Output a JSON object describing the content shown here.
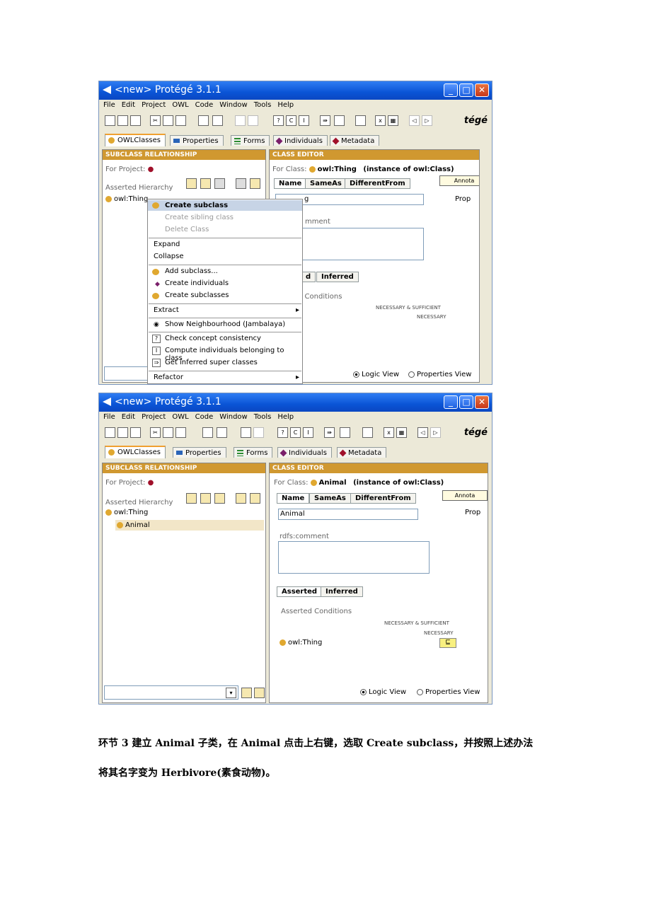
{
  "window": {
    "title": "<new>  Protégé 3.1.1"
  },
  "menu": [
    "File",
    "Edit",
    "Project",
    "OWL",
    "Code",
    "Window",
    "Tools",
    "Help"
  ],
  "logo_text": "tégé",
  "tabs": [
    "OWLClasses",
    "Properties",
    "Forms",
    "Individuals",
    "Metadata"
  ],
  "left_pane": {
    "header": "SUBCLASS RELATIONSHIP",
    "for_project": "For Project:",
    "asserted_hierarchy": "Asserted Hierarchy",
    "root": "owl:Thing"
  },
  "right_pane": {
    "header": "CLASS EDITOR",
    "for_class": "For Class:",
    "instance_of": "(instance of owl:Class)",
    "subtabs": [
      "Name",
      "SameAs",
      "DifferentFrom"
    ],
    "annotations": "Annota",
    "prop": "Prop",
    "rdfs_comment": "rdfs:comment",
    "cond_tabs": [
      "Asserted",
      "Inferred"
    ],
    "asserted_conditions": "Asserted Conditions",
    "nec_suff": "NECESSARY & SUFFICIENT",
    "necessary": "NECESSARY",
    "logic_view": "Logic View",
    "properties_view": "Properties View"
  },
  "shot1": {
    "for_class_value": "owl:Thing",
    "name_fragment": "g",
    "comment_fragment": "mment",
    "cond_tab_fragment": "d",
    "cond_label_fragment": "d Conditions",
    "context_menu": [
      "Create subclass",
      "Create sibling class",
      "Delete Class",
      "Expand",
      "Collapse",
      "Add subclass...",
      "Create individuals",
      "Create subclasses",
      "Extract",
      "Show Neighbourhood (Jambalaya)",
      "Check concept consistency",
      "Compute individuals belonging to class",
      "Get inferred super classes",
      "Refactor"
    ]
  },
  "shot2": {
    "for_class_value": "Animal",
    "name_value": "Animal",
    "child_class": "Animal",
    "condition_class": "owl:Thing",
    "condition_symbol": "⊑"
  },
  "caption": {
    "line1": "环节 3  建立 Animal 子类，在 Animal 点击上右键，选取 Create subclass，并按照上述办法",
    "line2": "将其名字变为 Herbivore(素食动物)。"
  }
}
